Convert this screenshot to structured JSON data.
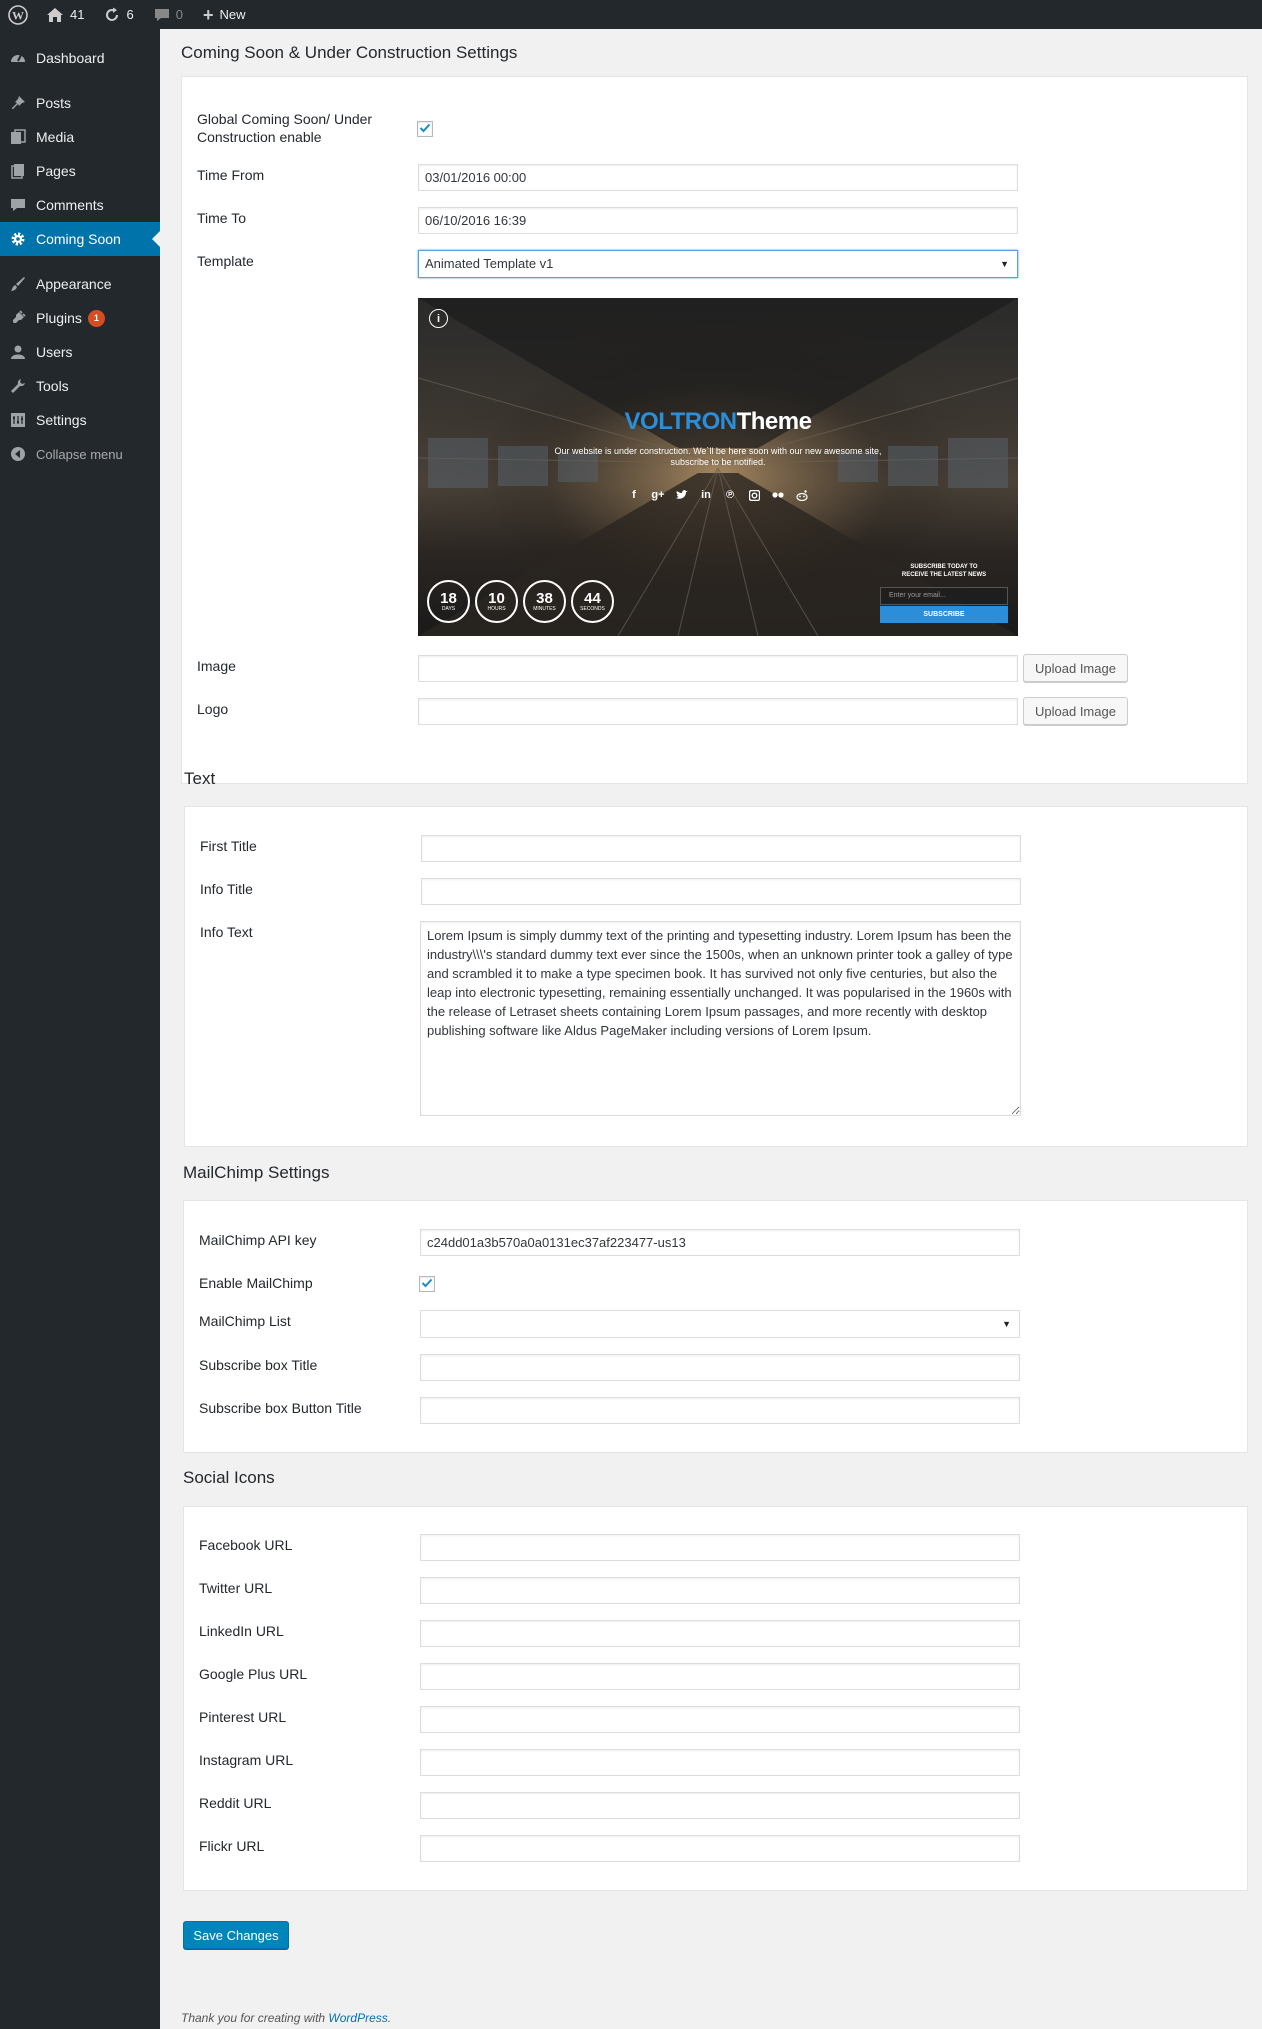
{
  "adminbar": {
    "home_count": "41",
    "updates_count": "6",
    "comments_count": "0",
    "new_label": "New"
  },
  "sidebar": {
    "items": [
      {
        "label": "Dashboard",
        "icon": "dashboard-icon"
      },
      {
        "label": "Posts",
        "icon": "pin-icon"
      },
      {
        "label": "Media",
        "icon": "media-icon"
      },
      {
        "label": "Pages",
        "icon": "pages-icon"
      },
      {
        "label": "Comments",
        "icon": "comment-icon"
      },
      {
        "label": "Coming Soon",
        "icon": "gear-icon"
      },
      {
        "label": "Appearance",
        "icon": "brush-icon"
      },
      {
        "label": "Plugins",
        "icon": "plug-icon",
        "badge": "1"
      },
      {
        "label": "Users",
        "icon": "user-icon"
      },
      {
        "label": "Tools",
        "icon": "wrench-icon"
      },
      {
        "label": "Settings",
        "icon": "settings-icon"
      },
      {
        "label": "Collapse menu",
        "icon": "collapse-icon"
      }
    ]
  },
  "main": {
    "title": "Coming Soon & Under Construction Settings",
    "general": {
      "enable_label": "Global Coming Soon/ Under Construction enable",
      "enable_checked": true,
      "time_from_label": "Time From",
      "time_from_value": "03/01/2016 00:00",
      "time_to_label": "Time To",
      "time_to_value": "06/10/2016 16:39",
      "template_label": "Template",
      "template_value": "Animated Template v1",
      "image_label": "Image",
      "logo_label": "Logo",
      "upload_label": "Upload Image"
    },
    "preview": {
      "title_blue": "VOLTRON",
      "title_white": "Theme",
      "text_line1": "Our website is under construction. We`ll be here soon with our new awesome site,",
      "text_line2": "subscribe to be notified.",
      "countdown": [
        {
          "value": "18",
          "unit": "DAYS"
        },
        {
          "value": "10",
          "unit": "HOURS"
        },
        {
          "value": "38",
          "unit": "MINUTES"
        },
        {
          "value": "44",
          "unit": "SECONDS"
        }
      ],
      "subscribe_line1": "SUBSCRIBE TODAY TO",
      "subscribe_line2": "RECEIVE THE LATEST NEWS",
      "email_placeholder": "Enter your email...",
      "subscribe_button": "SUBSCRIBE",
      "info_glyph": "i"
    },
    "text_section": {
      "heading": "Text",
      "first_title_label": "First Title",
      "info_title_label": "Info Title",
      "info_text_label": "Info Text",
      "info_text_value": "Lorem Ipsum is simply dummy text of the printing and typesetting industry. Lorem Ipsum has been the industry\\\\\\'s standard dummy text ever since the 1500s, when an unknown printer took a galley of type and scrambled it to make a type specimen book. It has survived not only five centuries, but also the leap into electronic typesetting, remaining essentially unchanged. It was popularised in the 1960s with the release of Letraset sheets containing Lorem Ipsum passages, and more recently with desktop publishing software like Aldus PageMaker including versions of Lorem Ipsum."
    },
    "mailchimp": {
      "heading": "MailChimp Settings",
      "api_key_label": "MailChimp API key",
      "api_key_value": "c24dd01a3b570a0a0131ec37af223477-us13",
      "enable_label": "Enable MailChimp",
      "enable_checked": true,
      "list_label": "MailChimp List",
      "box_title_label": "Subscribe box Title",
      "box_button_label": "Subscribe box Button Title"
    },
    "social": {
      "heading": "Social Icons",
      "fields": [
        "Facebook URL",
        "Twitter URL",
        "LinkedIn URL",
        "Google Plus URL",
        "Pinterest URL",
        "Instagram URL",
        "Reddit URL",
        "Flickr URL"
      ]
    },
    "save_label": "Save Changes"
  },
  "footer": {
    "text": "Thank you for creating with ",
    "link": "WordPress",
    "end": "."
  },
  "colors": {
    "accent": "#0073aa",
    "sidebar_bg": "#23282d",
    "brand_blue": "#2c8ed8"
  }
}
